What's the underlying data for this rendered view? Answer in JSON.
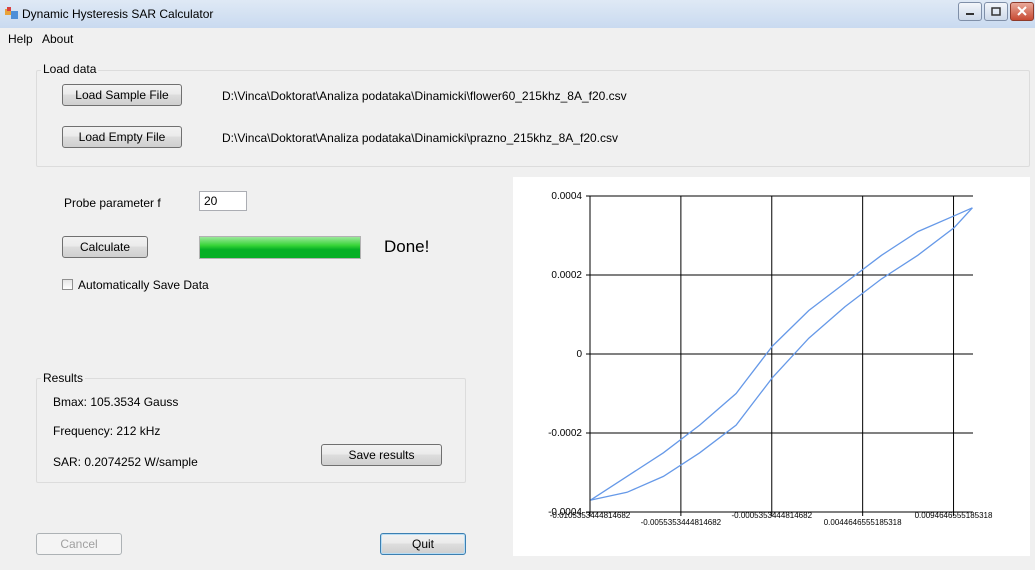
{
  "window": {
    "title": "Dynamic Hysteresis SAR Calculator"
  },
  "menu": [
    "Help",
    "About"
  ],
  "load_data": {
    "title": "Load data",
    "sample_button": "Load Sample File",
    "sample_path": "D:\\Vinca\\Doktorat\\Analiza podataka\\Dinamicki\\flower60_215khz_8A_f20.csv",
    "empty_button": "Load Empty File",
    "empty_path": "D:\\Vinca\\Doktorat\\Analiza podataka\\Dinamicki\\prazno_215khz_8A_f20.csv"
  },
  "probe": {
    "label": "Probe parameter f",
    "value": "20"
  },
  "calculate": {
    "button": "Calculate",
    "progress": 1.0,
    "status": "Done!"
  },
  "auto_save": {
    "label": "Automatically Save Data",
    "checked": false
  },
  "results": {
    "title": "Results",
    "bmax": "Bmax: 105.3534 Gauss",
    "frequency": "Frequency: 212 kHz",
    "sar": "SAR: 0.2074252 W/sample",
    "save_button": "Save results"
  },
  "buttons": {
    "cancel": "Cancel",
    "quit": "Quit"
  },
  "colors": {
    "accent": "#6699e8",
    "progress": "#06b025"
  },
  "chart_data": {
    "type": "line",
    "title": "",
    "xlabel": "",
    "ylabel": "",
    "xlim": [
      -0.0105353444814682,
      0.0105353444814682
    ],
    "ylim": [
      -0.0004,
      0.0004
    ],
    "grid": true,
    "x_ticks": [
      -0.0105353444814682,
      -0.0055353444814682,
      -0.0005353444814682,
      0.0044646555185318,
      0.0094646555185318
    ],
    "x_tick_labels": [
      "-0.0105353444814682",
      "-0.0055353444814682",
      "-0.0005353444814682",
      "0.0044646555185318",
      "0.0094646555185318"
    ],
    "y_ticks": [
      0.0004,
      0.0002,
      0,
      -0.0002,
      -0.0004
    ],
    "y_tick_labels": [
      "0.0004",
      "0.0002",
      "0",
      "-0.0002",
      "-0.0004"
    ],
    "series": [
      {
        "color": "#6699e8",
        "x": [
          -0.0105,
          -0.0085,
          -0.0065,
          -0.0045,
          -0.0025,
          -0.0005,
          0.0015,
          0.0035,
          0.0055,
          0.0075,
          0.0095,
          0.0105
        ],
        "y": [
          -0.00037,
          -0.00031,
          -0.00025,
          -0.00018,
          -0.0001,
          2e-05,
          0.00011,
          0.00018,
          0.00025,
          0.00031,
          0.00035,
          0.00037
        ]
      },
      {
        "color": "#6699e8",
        "x": [
          -0.0105,
          -0.0085,
          -0.0065,
          -0.0045,
          -0.0025,
          -0.0005,
          0.0015,
          0.0035,
          0.0055,
          0.0075,
          0.0095,
          0.0105
        ],
        "y": [
          -0.00037,
          -0.00035,
          -0.00031,
          -0.00025,
          -0.00018,
          -6e-05,
          4e-05,
          0.00012,
          0.00019,
          0.00025,
          0.00032,
          0.00037
        ]
      }
    ]
  }
}
